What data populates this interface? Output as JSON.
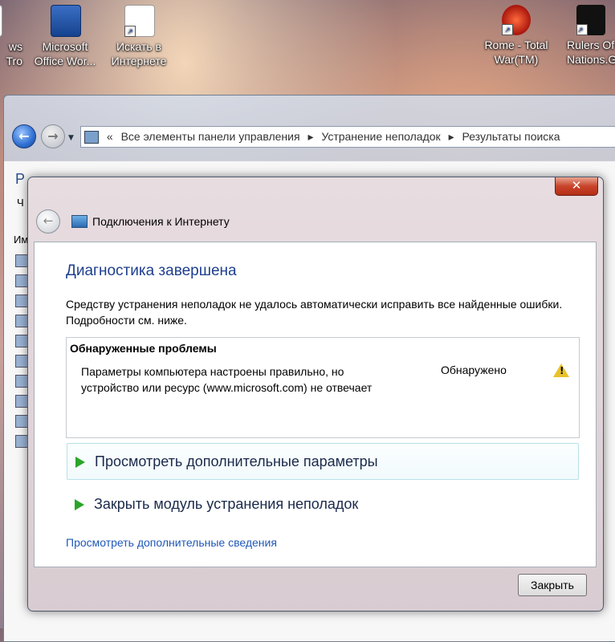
{
  "desktop": {
    "icons": [
      {
        "label_line1": "ws",
        "label_line2": "Tro"
      },
      {
        "label_line1": "Microsoft",
        "label_line2": "Office Wor..."
      },
      {
        "label_line1": "Искать в",
        "label_line2": "Интернете"
      },
      {
        "label_line1": "Rome - Total",
        "label_line2": "War(TM)"
      },
      {
        "label_line1": "Rulers Of",
        "label_line2": "Nations.Ge"
      }
    ]
  },
  "explorer": {
    "address_prefix": "«",
    "breadcrumbs": [
      "Все элементы панели управления",
      "Устранение неполадок",
      "Результаты поиска"
    ],
    "separator": "▸",
    "title_cut": "Р",
    "subtitle_cut": "Ч",
    "col_cut": "Им"
  },
  "dialog": {
    "close_glyph": "✕",
    "back_glyph": "←",
    "title": "Подключения к Интернету",
    "heading": "Диагностика завершена",
    "description": "Средству устранения неполадок не удалось автоматически исправить все найденные ошибки. Подробности см. ниже.",
    "problems": {
      "title": "Обнаруженные проблемы",
      "items": [
        {
          "text": "Параметры компьютера настроены правильно, но устройство или ресурс (www.microsoft.com) не отвечает",
          "status": "Обнаружено",
          "icon": "warning-icon"
        }
      ]
    },
    "options": [
      {
        "label": "Просмотреть дополнительные параметры"
      },
      {
        "label": "Закрыть модуль устранения неполадок"
      }
    ],
    "more_link": "Просмотреть дополнительные сведения",
    "close_button": "Закрыть"
  },
  "colors": {
    "heading_blue": "#1e3f8f",
    "link_blue": "#1f58b8",
    "arrow_green": "#2aa52a",
    "warning_yellow": "#e8c22a"
  }
}
